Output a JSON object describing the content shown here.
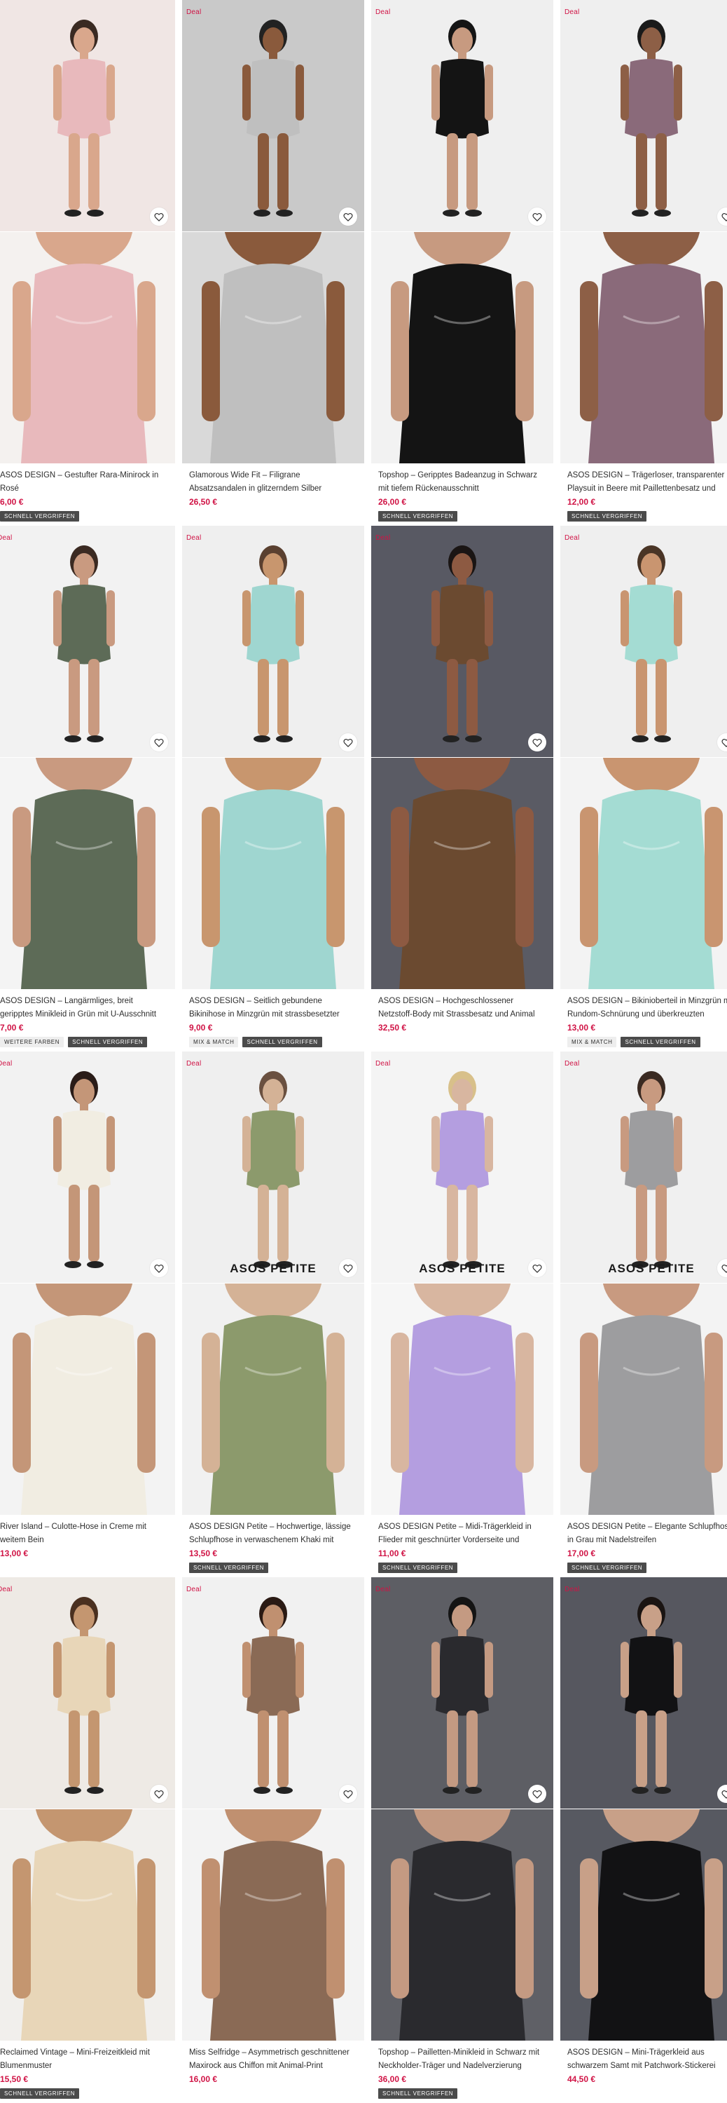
{
  "labels": {
    "deal": "Deal",
    "petite": "ASOS PETITE"
  },
  "colors": {
    "price": "#d01345",
    "deal": "#d01345",
    "badge_dark": "#4b4b4b",
    "badge_light": "#eeeeee"
  },
  "products": [
    {
      "title": "ASOS DESIGN – Gestufter Rara-Minirock in Rosé",
      "price": "6,00 €",
      "deal": false,
      "petite": false,
      "badges": [
        {
          "text": "SCHNELL VERGRIFFEN",
          "style": "dark"
        }
      ]
    },
    {
      "title": "Glamorous Wide Fit – Filigrane Absatzsandalen in glitzerndem Silber",
      "price": "26,50 €",
      "deal": true,
      "petite": false,
      "badges": []
    },
    {
      "title": "Topshop – Geripptes Badeanzug in Schwarz mit tiefem Rückenausschnitt",
      "price": "26,00 €",
      "deal": true,
      "petite": false,
      "badges": [
        {
          "text": "SCHNELL VERGRIFFEN",
          "style": "dark"
        }
      ]
    },
    {
      "title": "ASOS DESIGN – Trägerloser, transparenter Playsuit in Beere mit Paillettenbesatz und verdrehtem Detail",
      "price": "12,00 €",
      "deal": true,
      "petite": false,
      "badges": [
        {
          "text": "SCHNELL VERGRIFFEN",
          "style": "dark"
        }
      ]
    },
    {
      "title": "ASOS DESIGN – Langärmliges, breit geripptes Minikleid in Grün mit U-Ausschnitt",
      "price": "7,00 €",
      "deal": true,
      "petite": false,
      "badges": [
        {
          "text": "WEITERE FARBEN",
          "style": "light"
        },
        {
          "text": "SCHNELL VERGRIFFEN",
          "style": "dark"
        }
      ]
    },
    {
      "title": "ASOS DESIGN – Seitlich gebundene Bikinihose in Minzgrün mit strassbesetzter Vorderseite",
      "price": "9,00 €",
      "deal": true,
      "petite": false,
      "badges": [
        {
          "text": "MIX & MATCH",
          "style": "light"
        },
        {
          "text": "SCHNELL VERGRIFFEN",
          "style": "dark"
        }
      ]
    },
    {
      "title": "ASOS DESIGN – Hochgeschlossener Netzstoff-Body mit Strassbesatz und Animal Print",
      "price": "32,50 €",
      "deal": true,
      "petite": false,
      "badges": []
    },
    {
      "title": "ASOS DESIGN – Bikinioberteil in Minzgrün mit Rundom-Schnürung und überkreuzten Ausschnitt",
      "price": "13,00 €",
      "deal": true,
      "petite": false,
      "badges": [
        {
          "text": "MIX & MATCH",
          "style": "light"
        },
        {
          "text": "SCHNELL VERGRIFFEN",
          "style": "dark"
        }
      ]
    },
    {
      "title": "River Island – Culotte-Hose in Creme mit weitem Bein",
      "price": "13,00 €",
      "deal": true,
      "petite": false,
      "badges": []
    },
    {
      "title": "ASOS DESIGN Petite – Hochwertige, lässige Schlupfhose in verwaschenem Khaki mit Bundfalten",
      "price": "13,50 €",
      "deal": true,
      "petite": true,
      "badges": [
        {
          "text": "SCHNELL VERGRIFFEN",
          "style": "dark"
        }
      ]
    },
    {
      "title": "ASOS DESIGN Petite – Midi-Trägerkleid in Flieder mit geschnürter Vorderseite und gerafftem Rocktei",
      "price": "11,00 €",
      "deal": true,
      "petite": true,
      "badges": [
        {
          "text": "SCHNELL VERGRIFFEN",
          "style": "dark"
        }
      ]
    },
    {
      "title": "ASOS DESIGN Petite – Elegante Schlupfhose in Grau mit Nadelstreifen",
      "price": "17,00 €",
      "deal": true,
      "petite": true,
      "badges": [
        {
          "text": "SCHNELL VERGRIFFEN",
          "style": "dark"
        }
      ]
    },
    {
      "title": "Reclaimed Vintage – Mini-Freizeitkleid mit Blumenmuster",
      "price": "15,50 €",
      "deal": true,
      "petite": false,
      "badges": [
        {
          "text": "SCHNELL VERGRIFFEN",
          "style": "dark"
        }
      ]
    },
    {
      "title": "Miss Selfridge – Asymmetrisch geschnittener Maxirock aus Chiffon mit Animal-Print",
      "price": "16,00 €",
      "deal": true,
      "petite": false,
      "badges": []
    },
    {
      "title": "Topshop – Pailletten-Minikleid in Schwarz mit Neckholder-Träger und Nadelverzierung",
      "price": "36,00 €",
      "deal": true,
      "petite": false,
      "badges": [
        {
          "text": "SCHNELL VERGRIFFEN",
          "style": "dark"
        }
      ]
    },
    {
      "title": "ASOS DESIGN – Mini-Trägerkleid aus schwarzem Samt mit Patchwork-Stickerei",
      "price": "44,50 €",
      "deal": true,
      "petite": false,
      "badges": []
    }
  ]
}
